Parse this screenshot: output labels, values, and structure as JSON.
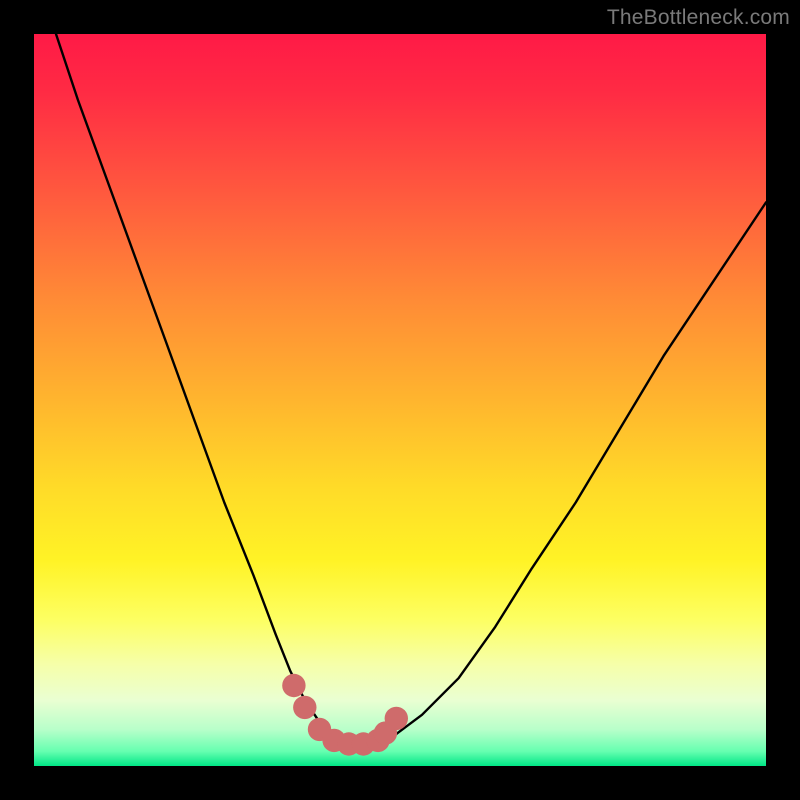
{
  "watermark": "TheBottleneck.com",
  "colors": {
    "frame": "#000000",
    "curve": "#000000",
    "markers": "#cf6b6b",
    "gradient_top": "#ff1a46",
    "gradient_bottom": "#00e686"
  },
  "chart_data": {
    "type": "line",
    "title": "",
    "xlabel": "",
    "ylabel": "",
    "xlim": [
      0,
      100
    ],
    "ylim": [
      0,
      100
    ],
    "grid": false,
    "legend": false,
    "series": [
      {
        "name": "bottleneck-curve",
        "x": [
          3,
          6,
          10,
          14,
          18,
          22,
          26,
          30,
          33,
          35,
          37,
          39,
          41,
          43,
          45,
          47,
          49,
          53,
          58,
          63,
          68,
          74,
          80,
          86,
          92,
          100
        ],
        "y": [
          100,
          91,
          80,
          69,
          58,
          47,
          36,
          26,
          18,
          13,
          9,
          6,
          4,
          3,
          3,
          3,
          4,
          7,
          12,
          19,
          27,
          36,
          46,
          56,
          65,
          77
        ]
      }
    ],
    "markers": {
      "name": "highlight-points",
      "x": [
        35.5,
        37,
        39,
        41,
        43,
        45,
        47,
        48,
        49.5
      ],
      "y": [
        11,
        8,
        5,
        3.5,
        3,
        3,
        3.5,
        4.5,
        6.5
      ],
      "r": 1.6
    }
  }
}
